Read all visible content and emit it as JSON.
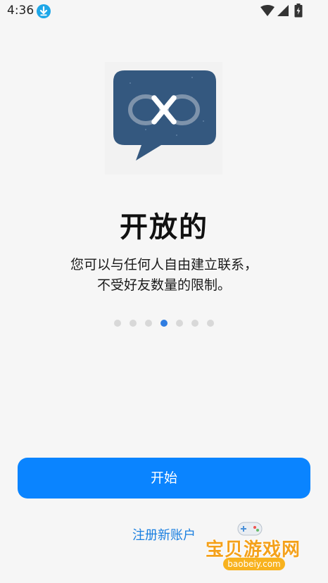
{
  "status_bar": {
    "time": "4:36",
    "icons": [
      "download-icon",
      "wifi-icon",
      "signal-icon",
      "battery-icon"
    ]
  },
  "onboarding": {
    "title": "开放的",
    "description_lines": [
      "您可以与任何人自由建立联系，",
      "不受好友数量的限制。"
    ],
    "page_count": 7,
    "active_page_index": 3
  },
  "actions": {
    "start_label": "开始",
    "register_label": "注册新账户"
  },
  "watermark": {
    "title": "宝贝游戏网",
    "url": "baobeiy.com"
  },
  "colors": {
    "accent": "#0a84ff",
    "link": "#1a7fe0",
    "bubble": "#34587f",
    "dot_active": "#2f7de1",
    "dot_inactive": "#d8d8d8"
  }
}
